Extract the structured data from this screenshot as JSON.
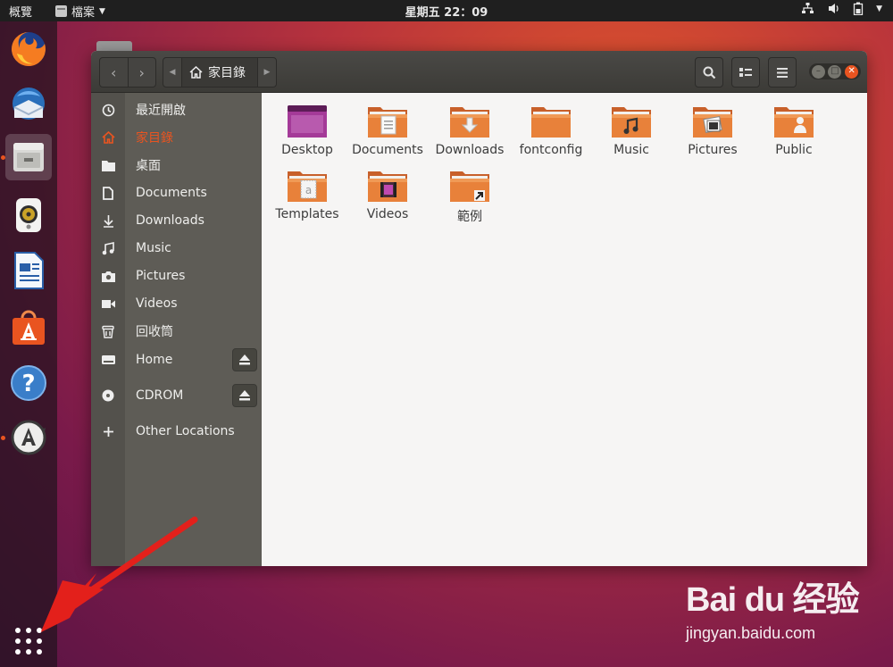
{
  "topbar": {
    "activities": "概覽",
    "app_menu": "檔案",
    "clock": "星期五 22：09",
    "tray_icons": [
      "network-icon",
      "volume-icon",
      "battery-icon",
      "chevron-down-icon"
    ]
  },
  "dock": {
    "apps": [
      {
        "name": "firefox-icon",
        "running": false,
        "active": false
      },
      {
        "name": "thunderbird-icon",
        "running": false,
        "active": false
      },
      {
        "name": "files-icon",
        "running": true,
        "active": true
      },
      {
        "name": "rhythmbox-icon",
        "running": false,
        "active": false
      },
      {
        "name": "writer-icon",
        "running": false,
        "active": false
      },
      {
        "name": "software-icon",
        "running": false,
        "active": false
      },
      {
        "name": "help-icon",
        "running": false,
        "active": false
      },
      {
        "name": "software-updater-icon",
        "running": true,
        "active": false
      }
    ],
    "show_apps": "app-grid-icon"
  },
  "window": {
    "path_crumb": "家目錄",
    "sidebar": [
      {
        "icon": "recent-icon",
        "label": "最近開啟",
        "selected": false
      },
      {
        "icon": "home-icon",
        "label": "家目錄",
        "selected": true
      },
      {
        "icon": "desktop-icon",
        "label": "桌面",
        "selected": false
      },
      {
        "icon": "document-icon",
        "label": "Documents",
        "selected": false
      },
      {
        "icon": "download-icon",
        "label": "Downloads",
        "selected": false
      },
      {
        "icon": "music-icon",
        "label": "Music",
        "selected": false
      },
      {
        "icon": "camera-icon",
        "label": "Pictures",
        "selected": false
      },
      {
        "icon": "video-icon",
        "label": "Videos",
        "selected": false
      },
      {
        "icon": "trash-icon",
        "label": "回收筒",
        "selected": false
      },
      {
        "icon": "drive-icon",
        "label": "Home",
        "selected": false,
        "eject": true
      },
      {
        "icon": "disc-icon",
        "label": "CDROM",
        "selected": false,
        "eject": true
      },
      {
        "icon": "plus-icon",
        "label": "Other Locations",
        "selected": false
      }
    ],
    "files": [
      {
        "name": "Desktop",
        "kind": "desktop"
      },
      {
        "name": "Documents",
        "kind": "documents"
      },
      {
        "name": "Downloads",
        "kind": "downloads"
      },
      {
        "name": "fontconfig",
        "kind": "plain"
      },
      {
        "name": "Music",
        "kind": "music"
      },
      {
        "name": "Pictures",
        "kind": "pictures"
      },
      {
        "name": "Public",
        "kind": "public"
      },
      {
        "name": "Templates",
        "kind": "templates"
      },
      {
        "name": "Videos",
        "kind": "videos"
      },
      {
        "name": "範例",
        "kind": "link"
      }
    ]
  },
  "watermark": {
    "logo": "Bai du 经验",
    "url": "jingyan.baidu.com"
  },
  "colors": {
    "accent": "#e95420",
    "folder": "#e8813a",
    "sidebar": "#5e5c56",
    "headerbar": "#3c3b37"
  }
}
